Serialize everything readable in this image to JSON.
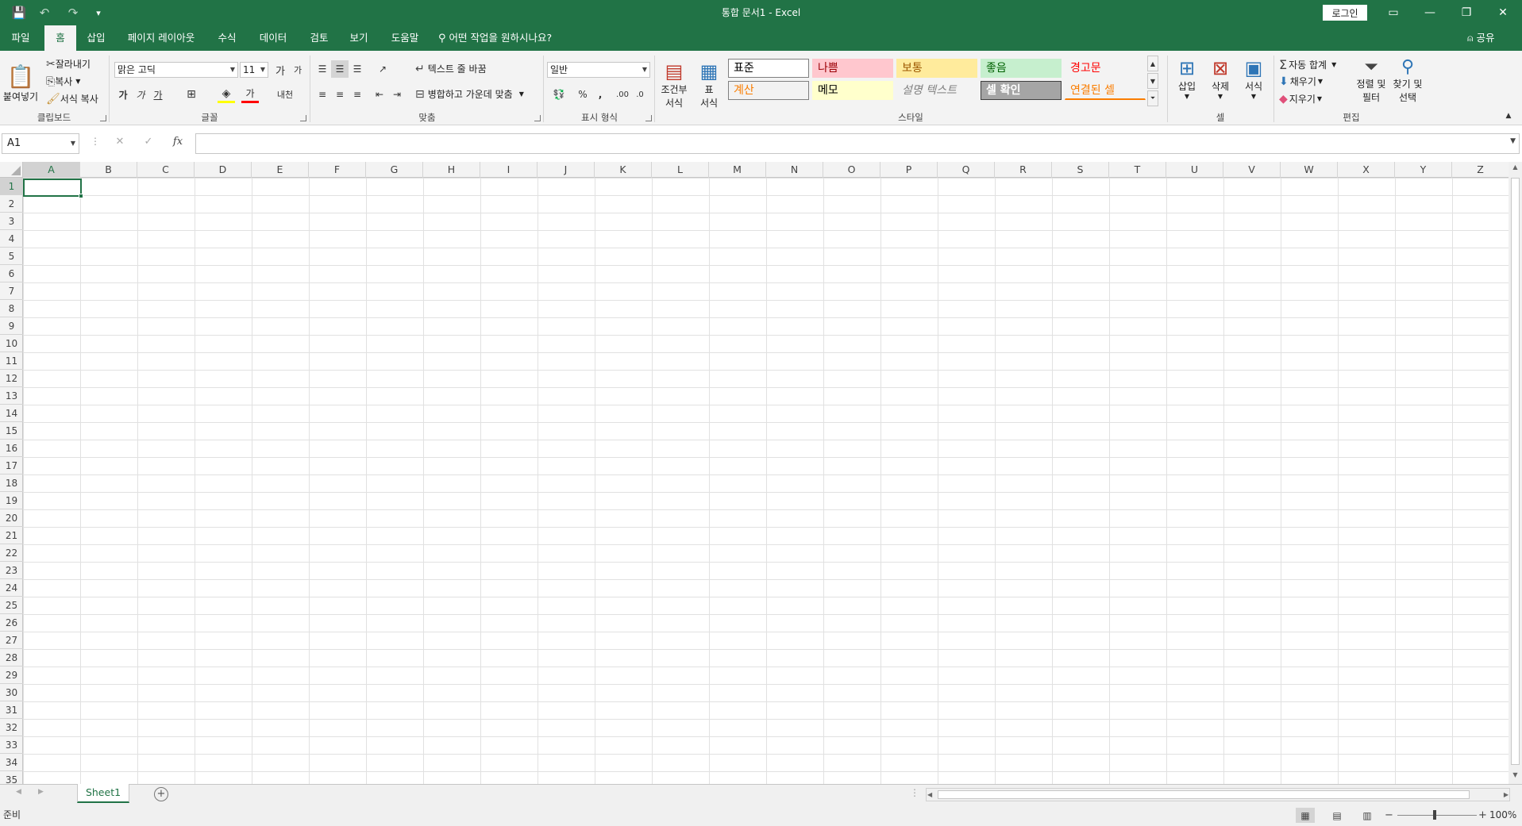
{
  "window": {
    "title": "통합 문서1  -  Excel",
    "login_label": "로그인",
    "minimize_icon": "—",
    "restore_icon": "❐",
    "close_icon": "✕",
    "ribbon_display_icon": "▭"
  },
  "quick_access": {
    "save_icon": "💾",
    "undo_icon": "↶",
    "redo_icon": "↷",
    "customize_icon": "▾"
  },
  "tabs": [
    {
      "label": "파일"
    },
    {
      "label": "홈",
      "active": true
    },
    {
      "label": "삽입"
    },
    {
      "label": "페이지 레이아웃"
    },
    {
      "label": "수식"
    },
    {
      "label": "데이터"
    },
    {
      "label": "검토"
    },
    {
      "label": "보기"
    },
    {
      "label": "도움말"
    }
  ],
  "tell_me": "어떤 작업을 원하시나요?",
  "share_label": "공유",
  "ribbon": {
    "clipboard": {
      "label": "클립보드",
      "paste": "붙여넣기",
      "cut": "잘라내기",
      "copy": "복사",
      "format_painter": "서식 복사"
    },
    "font": {
      "label": "글꼴",
      "font_name": "맑은 고딕",
      "font_size": "11",
      "bold": "가",
      "italic": "가",
      "underline": "가",
      "font_color_glyph": "가",
      "phonetic": "내천",
      "increase_size": "가",
      "decrease_size": "가"
    },
    "alignment": {
      "label": "맞춤",
      "wrap_text": "텍스트 줄 바꿈",
      "merge_center": "병합하고 가운데 맞춤"
    },
    "number": {
      "label": "표시 형식",
      "format": "일반"
    },
    "styles": {
      "label": "스타일",
      "conditional_format": [
        "조건부",
        "서식"
      ],
      "format_as_table": [
        "표",
        "서식"
      ],
      "cells": [
        {
          "name": "표준",
          "bg": "#ffffff",
          "fg": "#000000"
        },
        {
          "name": "나쁨",
          "bg": "#ffc7ce",
          "fg": "#9c0006"
        },
        {
          "name": "보통",
          "bg": "#ffeb9c",
          "fg": "#9c5700"
        },
        {
          "name": "좋음",
          "bg": "#c6efce",
          "fg": "#006100"
        },
        {
          "name": "경고문",
          "bg": "#f3f3f3",
          "fg": "#ff0000"
        },
        {
          "name": "계산",
          "bg": "#f2f2f2",
          "fg": "#fa7d00"
        },
        {
          "name": "메모",
          "bg": "#ffffcc",
          "fg": "#000000"
        },
        {
          "name": "설명 텍스트",
          "bg": "#f3f3f3",
          "fg": "#7f7f7f"
        },
        {
          "name": "셀 확인",
          "bg": "#a5a5a5",
          "fg": "#ffffff"
        },
        {
          "name": "연결된 셀",
          "bg": "#f3f3f3",
          "fg": "#fa7d00"
        }
      ]
    },
    "cells": {
      "label": "셀",
      "insert": "삽입",
      "delete": "삭제",
      "format": "서식"
    },
    "editing": {
      "label": "편집",
      "autosum": "자동 합계",
      "fill": "채우기",
      "clear": "지우기",
      "sort_filter": [
        "정렬 및",
        "필터"
      ],
      "find_select": [
        "찾기 및",
        "선택"
      ]
    }
  },
  "formula_bar": {
    "name_box": "A1",
    "cancel_icon": "✕",
    "enter_icon": "✓",
    "fx_label": "fx",
    "value": ""
  },
  "grid": {
    "columns": [
      "A",
      "B",
      "C",
      "D",
      "E",
      "F",
      "G",
      "H",
      "I",
      "J",
      "K",
      "L",
      "M",
      "N",
      "O",
      "P",
      "Q",
      "R",
      "S",
      "T",
      "U",
      "V",
      "W",
      "X",
      "Y",
      "Z"
    ],
    "rows": [
      "1",
      "2",
      "3",
      "4",
      "5",
      "6",
      "7",
      "8",
      "9",
      "10",
      "11",
      "12",
      "13",
      "14",
      "15",
      "16",
      "17",
      "18",
      "19",
      "20",
      "21",
      "22",
      "23",
      "24",
      "25",
      "26",
      "27",
      "28",
      "29",
      "30",
      "31",
      "32",
      "33",
      "34",
      "35"
    ],
    "active_cell": "A1"
  },
  "sheets": [
    {
      "name": "Sheet1",
      "active": true
    }
  ],
  "status": {
    "text": "준비",
    "zoom": "100%",
    "zoom_minus": "−",
    "zoom_plus": "+"
  },
  "colors": {
    "accent": "#217346",
    "ribbon_bg": "#f3f3f3",
    "gridline": "#e1e1e1"
  }
}
